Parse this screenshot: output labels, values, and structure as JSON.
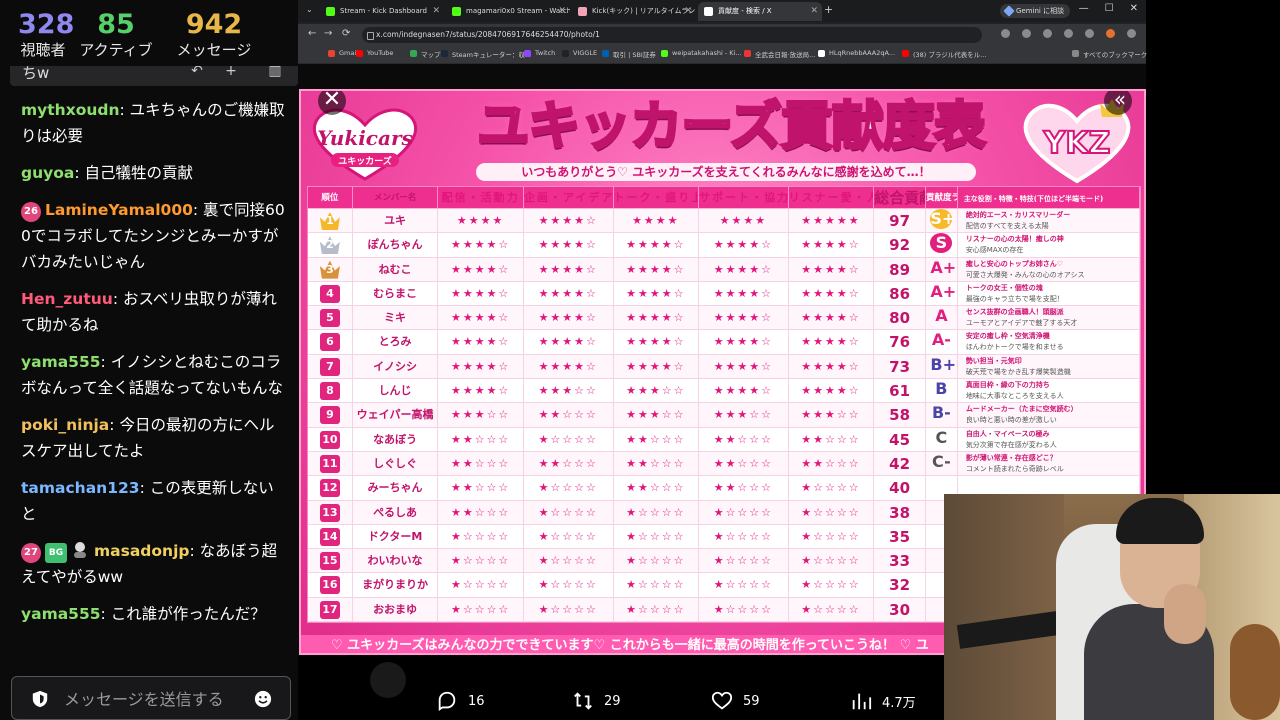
{
  "chat": {
    "stats": [
      {
        "value": "328",
        "label": "視聴者"
      },
      {
        "value": "85",
        "label": "アクティブ"
      },
      {
        "value": "942",
        "label": "メッセージ"
      }
    ],
    "topbar_text": "ちw",
    "messages": [
      {
        "user": "mythxoudn",
        "color": "#8ee06e",
        "text": "ユキちゃんのご機嫌取りは必要",
        "badge": ""
      },
      {
        "user": "guyoa",
        "color": "#8ee06e",
        "text": "自己犠牲の貢献",
        "badge": ""
      },
      {
        "user": "LamineYamal000",
        "color": "#ff9a2e",
        "text": "裏で同接600でコラボしてたシンジとみーかすがバカみたいじゃん",
        "badge": "26"
      },
      {
        "user": "Hen_zutuu",
        "color": "#ff5a7a",
        "text": "おスベリ虫取りが薄れて助かるね",
        "badge": ""
      },
      {
        "user": "yama555",
        "color": "#8ee06e",
        "text": "イノシシとねむこのコラボなんって全く話題なってないもんな",
        "badge": ""
      },
      {
        "user": "poki_ninja",
        "color": "#f0c060",
        "text": "今日の最初の方にヘルスケア出してたよ",
        "badge": ""
      },
      {
        "user": "tamachan123",
        "color": "#7ab8ff",
        "text": "この表更新しないと",
        "badge": ""
      },
      {
        "user": "masadonjp",
        "color": "#f0d060",
        "text": "なあぼう超えてやがるww",
        "badge": "27"
      },
      {
        "user": "yama555",
        "color": "#8ee06e",
        "text": "これ誰が作ったんだ？",
        "badge": ""
      }
    ],
    "input_placeholder": "メッセージを送信する"
  },
  "browser": {
    "tabs": [
      {
        "label": "Stream - Kick Dashboard",
        "color": "#53fc18"
      },
      {
        "label": "magamari0x0 Stream - Watch Liv...",
        "color": "#53fc18"
      },
      {
        "label": "Kick(キック) | リアルタイムランキング",
        "color": "#f2a3b5"
      },
      {
        "label": "貢献度 - 検索 / X",
        "color": "#ffffff"
      }
    ],
    "gemini_label": "Gemini に相談",
    "url": "x.com/indegnasen7/status/2084706917646254470/photo/1",
    "bookmarks": [
      {
        "label": "Gmail",
        "color": "#ea4335"
      },
      {
        "label": "YouTube",
        "color": "#ff0000"
      },
      {
        "label": "マップ",
        "color": "#34a853"
      },
      {
        "label": "Steamキュレーター：収...",
        "color": "#1b2838"
      },
      {
        "label": "Twitch",
        "color": "#9146ff"
      },
      {
        "label": "VIGGLE",
        "color": "#222222"
      },
      {
        "label": "取引 | SBI証券",
        "color": "#0060b0"
      },
      {
        "label": "weipatakahashi - Ki...",
        "color": "#53fc18"
      },
      {
        "label": "全武会日報·放送局...",
        "color": "#e33"
      },
      {
        "label": "HLqRnebbAAA2qA...",
        "color": "#ffffff"
      },
      {
        "label": "(38) ブラジル代表をル...",
        "color": "#ff0000"
      },
      {
        "label": "すべてのブックマーク",
        "color": "#888888"
      }
    ]
  },
  "image": {
    "logo_left_text": "Yukicars",
    "logo_left_sub": "ユキッカーズ",
    "logo_right_text": "YKZ",
    "title": "ユキッカーズ貢献度表",
    "subtitle": "いつもありがとう♡ ユキッカーズを支えてくれるみんなに感謝を込めて…！",
    "headers": [
      "順位",
      "メンバー名",
      "配信・活動力",
      "企画・アイデア力",
      "トーク・盛り上げ力",
      "サポート・協力力",
      "リスナー愛・人気",
      "総合貢献度(100点満点)",
      "貢献度ランク",
      "主な役割・特徴・特技(下位ほど半端モード)"
    ],
    "rows": [
      {
        "rank": "1",
        "name": "ユキ",
        "stars": [
          "★★★★",
          "★★★★☆",
          "★★★★",
          "★★★★",
          "★★★★★"
        ],
        "score": "97",
        "grade": "S+",
        "d1": "絶対的エース・カリスマリーダー",
        "d2": "配信のすべてを支える太陽"
      },
      {
        "rank": "2",
        "name": "ぽんちゃん",
        "stars": [
          "★★★★☆",
          "★★★★☆",
          "★★★★☆",
          "★★★★☆",
          "★★★★☆"
        ],
        "score": "92",
        "grade": "S",
        "d1": "リスナーの心の太陽！癒しの神",
        "d2": "安心感MAXの存在"
      },
      {
        "rank": "3",
        "name": "ねむこ",
        "stars": [
          "★★★★☆",
          "★★★★☆",
          "★★★★☆",
          "★★★★☆",
          "★★★★☆"
        ],
        "score": "89",
        "grade": "A+",
        "d1": "癒しと安心のトップお姉さん♡",
        "d2": "可愛さ大爆発・みんなの心のオアシス"
      },
      {
        "rank": "4",
        "name": "むらまこ",
        "stars": [
          "★★★★☆",
          "★★★★☆",
          "★★★★☆",
          "★★★★☆",
          "★★★★☆"
        ],
        "score": "86",
        "grade": "A+",
        "d1": "トークの女王・個性の塊",
        "d2": "最強のキャラ立ちで場を支配！"
      },
      {
        "rank": "5",
        "name": "ミキ",
        "stars": [
          "★★★★☆",
          "★★★★☆",
          "★★★★☆",
          "★★★★☆",
          "★★★★☆"
        ],
        "score": "80",
        "grade": "A",
        "d1": "センス抜群の企画職人！頭脳派",
        "d2": "ユーモアとアイデアで魅了する天才"
      },
      {
        "rank": "6",
        "name": "とろみ",
        "stars": [
          "★★★★☆",
          "★★★★☆",
          "★★★★☆",
          "★★★★☆",
          "★★★★☆"
        ],
        "score": "76",
        "grade": "A-",
        "d1": "安定の癒し枠・空気清浄機",
        "d2": "ほんわかトークで場を和ませる"
      },
      {
        "rank": "7",
        "name": "イノシシ",
        "stars": [
          "★★★★☆",
          "★★★★☆",
          "★★★★☆",
          "★★★★☆",
          "★★★★☆"
        ],
        "score": "73",
        "grade": "B+",
        "d1": "勢い担当・元気印",
        "d2": "破天荒で場をかき乱す爆笑製造機"
      },
      {
        "rank": "8",
        "name": "しんじ",
        "stars": [
          "★★★★☆",
          "★★★☆☆",
          "★★★☆☆",
          "★★★★☆",
          "★★★★☆"
        ],
        "score": "61",
        "grade": "B",
        "d1": "真面目枠・縁の下の力持ち",
        "d2": "地味に大事なところを支える人"
      },
      {
        "rank": "9",
        "name": "ウェイパー高橋",
        "stars": [
          "★★★☆☆",
          "★★☆☆☆",
          "★★★☆☆",
          "★★★☆☆",
          "★★★☆☆"
        ],
        "score": "58",
        "grade": "B-",
        "d1": "ムードメーカー（たまに空気読む）",
        "d2": "良い時と悪い時の差が激しい"
      },
      {
        "rank": "10",
        "name": "なあぼう",
        "stars": [
          "★★☆☆☆",
          "★☆☆☆☆",
          "★★☆☆☆",
          "★★☆☆☆",
          "★★☆☆☆"
        ],
        "score": "45",
        "grade": "C",
        "d1": "自由人・マイペースの極み",
        "d2": "気分次第で存在感が変わる人"
      },
      {
        "rank": "11",
        "name": "しぐしぐ",
        "stars": [
          "★★☆☆☆",
          "★★☆☆☆",
          "★★☆☆☆",
          "★★☆☆☆",
          "★★☆☆☆"
        ],
        "score": "42",
        "grade": "C-",
        "d1": "影が薄い常連・存在感どこ？",
        "d2": "コメント読まれたら奇跡レベル"
      },
      {
        "rank": "12",
        "name": "みーちゃん",
        "stars": [
          "★★☆☆☆",
          "★☆☆☆☆",
          "★★☆☆☆",
          "★★☆☆☆",
          "★☆☆☆☆"
        ],
        "score": "40",
        "grade": "",
        "d1": "",
        "d2": ""
      },
      {
        "rank": "13",
        "name": "ぺるしあ",
        "stars": [
          "★★☆☆☆",
          "★☆☆☆☆",
          "★☆☆☆☆",
          "★☆☆☆☆",
          "★☆☆☆☆"
        ],
        "score": "38",
        "grade": "",
        "d1": "",
        "d2": ""
      },
      {
        "rank": "14",
        "name": "ドクターM",
        "stars": [
          "★☆☆☆☆",
          "★☆☆☆☆",
          "★☆☆☆☆",
          "★☆☆☆☆",
          "★☆☆☆☆"
        ],
        "score": "35",
        "grade": "",
        "d1": "",
        "d2": ""
      },
      {
        "rank": "15",
        "name": "わいわいな",
        "stars": [
          "★☆☆☆☆",
          "★☆☆☆☆",
          "★☆☆☆☆",
          "★☆☆☆☆",
          "★☆☆☆☆"
        ],
        "score": "33",
        "grade": "",
        "d1": "",
        "d2": ""
      },
      {
        "rank": "16",
        "name": "まがりまりか",
        "stars": [
          "★☆☆☆☆",
          "★☆☆☆☆",
          "★☆☆☆☆",
          "★☆☆☆☆",
          "★☆☆☆☆"
        ],
        "score": "32",
        "grade": "",
        "d1": "",
        "d2": ""
      },
      {
        "rank": "17",
        "name": "おおまゆ",
        "stars": [
          "★☆☆☆☆",
          "★☆☆☆☆",
          "★☆☆☆☆",
          "★☆☆☆☆",
          "★☆☆☆☆"
        ],
        "score": "30",
        "grade": "",
        "d1": "",
        "d2": ""
      }
    ],
    "footer": "♡ ユキッカーズはみんなの力でできています♡  これからも一緒に最高の時間を作っていこうね！ ♡ ユ"
  },
  "actions": {
    "replies": "16",
    "reposts": "29",
    "likes": "59",
    "views": "4.7万"
  }
}
